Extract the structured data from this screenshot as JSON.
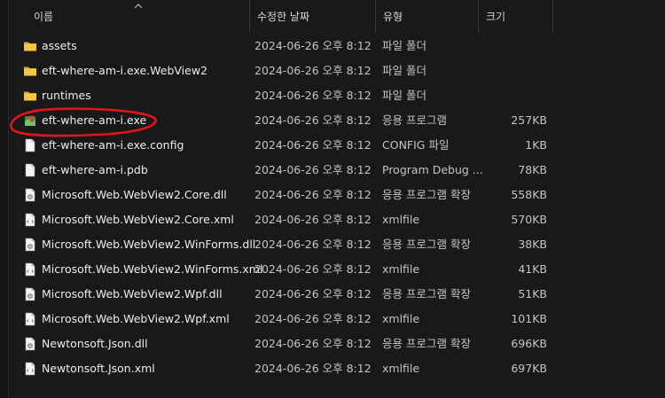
{
  "header": {
    "name": "이름",
    "date": "수정한 날짜",
    "type": "유형",
    "size": "크기"
  },
  "files": [
    {
      "name": "assets",
      "date": "2024-06-26 오후 8:12",
      "type": "파일 폴더",
      "size": "",
      "icon": "folder-icon"
    },
    {
      "name": "eft-where-am-i.exe.WebView2",
      "date": "2024-06-26 오후 8:12",
      "type": "파일 폴더",
      "size": "",
      "icon": "folder-icon"
    },
    {
      "name": "runtimes",
      "date": "2024-06-26 오후 8:12",
      "type": "파일 폴더",
      "size": "",
      "icon": "folder-icon"
    },
    {
      "name": "eft-where-am-i.exe",
      "date": "2024-06-26 오후 8:12",
      "type": "응용 프로그램",
      "size": "257KB",
      "icon": "map-app-icon"
    },
    {
      "name": "eft-where-am-i.exe.config",
      "date": "2024-06-26 오후 8:12",
      "type": "CONFIG 파일",
      "size": "1KB",
      "icon": "file-icon"
    },
    {
      "name": "eft-where-am-i.pdb",
      "date": "2024-06-26 오후 8:12",
      "type": "Program Debug ...",
      "size": "78KB",
      "icon": "file-icon"
    },
    {
      "name": "Microsoft.Web.WebView2.Core.dll",
      "date": "2024-06-26 오후 8:12",
      "type": "응용 프로그램 확장",
      "size": "558KB",
      "icon": "dll-icon"
    },
    {
      "name": "Microsoft.Web.WebView2.Core.xml",
      "date": "2024-06-26 오후 8:12",
      "type": "xmlfile",
      "size": "570KB",
      "icon": "xml-icon"
    },
    {
      "name": "Microsoft.Web.WebView2.WinForms.dll",
      "date": "2024-06-26 오후 8:12",
      "type": "응용 프로그램 확장",
      "size": "38KB",
      "icon": "dll-icon"
    },
    {
      "name": "Microsoft.Web.WebView2.WinForms.xml",
      "date": "2024-06-26 오후 8:12",
      "type": "xmlfile",
      "size": "41KB",
      "icon": "xml-icon"
    },
    {
      "name": "Microsoft.Web.WebView2.Wpf.dll",
      "date": "2024-06-26 오후 8:12",
      "type": "응용 프로그램 확장",
      "size": "51KB",
      "icon": "dll-icon"
    },
    {
      "name": "Microsoft.Web.WebView2.Wpf.xml",
      "date": "2024-06-26 오후 8:12",
      "type": "xmlfile",
      "size": "101KB",
      "icon": "xml-icon"
    },
    {
      "name": "Newtonsoft.Json.dll",
      "date": "2024-06-26 오후 8:12",
      "type": "응용 프로그램 확장",
      "size": "696KB",
      "icon": "dll-icon"
    },
    {
      "name": "Newtonsoft.Json.xml",
      "date": "2024-06-26 오후 8:12",
      "type": "xmlfile",
      "size": "697KB",
      "icon": "xml-icon"
    }
  ],
  "colors": {
    "background": "#191919",
    "folder": "#f5c542",
    "annotation": "#e3141b"
  }
}
